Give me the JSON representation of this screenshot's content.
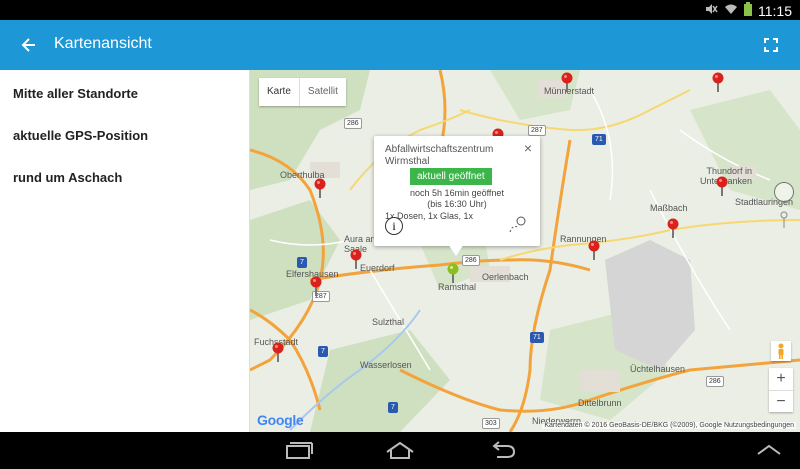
{
  "status_bar": {
    "time": "11:15"
  },
  "app_bar": {
    "title": "Kartenansicht"
  },
  "sidebar": {
    "items": [
      {
        "label": "Mitte aller Standorte"
      },
      {
        "label": "aktuelle GPS-Position"
      },
      {
        "label": "rund um Aschach"
      }
    ]
  },
  "map": {
    "map_type": {
      "map_label": "Karte",
      "satellite_label": "Satellit"
    },
    "places": [
      "Münnerstadt",
      "Oberthulba",
      "Aura an der Saale",
      "Euerdorf",
      "Elfershausen",
      "Ramsthal",
      "Oerlenbach",
      "Sulzthal",
      "Fuchsstadt",
      "Wasserlosen",
      "Thundorf in Unterfranken",
      "Maßbach",
      "Stadtlauringen",
      "Rannungen",
      "Üchtelhausen",
      "Dittelbrunn",
      "Niederwerrn"
    ],
    "road_numbers": [
      "286",
      "287",
      "71",
      "7",
      "287",
      "286",
      "71",
      "7",
      "7",
      "286",
      "303"
    ],
    "popup": {
      "title_line1": "Abfallwirtschaftszentrum",
      "title_line2": "Wirmsthal",
      "status_badge": "aktuell geöffnet",
      "open_for": "noch 5h 16min geöffnet",
      "until": "(bis 16:30 Uhr)",
      "materials": "1x Dosen, 1x Glas, 1x",
      "close_symbol": "×",
      "info_symbol": "i"
    },
    "zoom_in": "+",
    "zoom_out": "−",
    "google_logo": "Google",
    "attribution": "Kartendaten © 2016 GeoBasis-DE/BKG (©2009), Google   Nutzungsbedingungen"
  },
  "colors": {
    "app_bar": "#1e97d6",
    "badge": "#3cb54a",
    "pin_red": "#d9221c",
    "pin_green": "#8bbf1f"
  }
}
